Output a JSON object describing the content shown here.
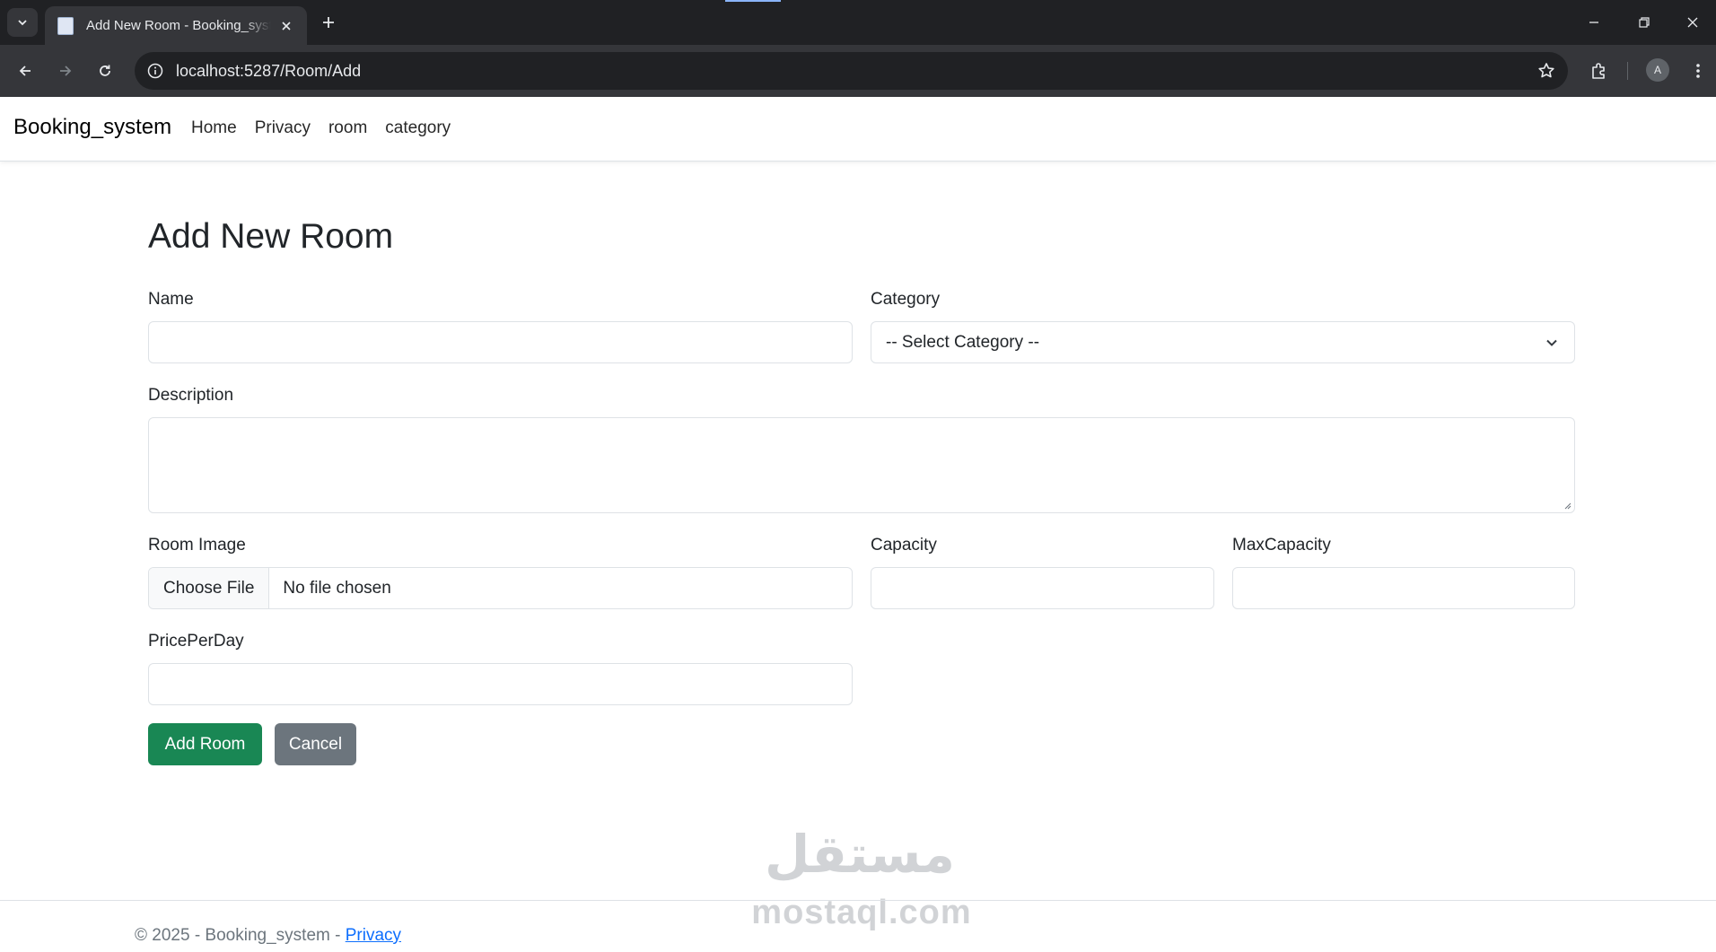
{
  "browser": {
    "tab_title": "Add New Room - Booking_system",
    "url": "localhost:5287/Room/Add",
    "profile_initial": "A"
  },
  "site": {
    "brand": "Booking_system",
    "nav": [
      "Home",
      "Privacy",
      "room",
      "category"
    ]
  },
  "page": {
    "title": "Add New Room"
  },
  "form": {
    "name_label": "Name",
    "name_value": "",
    "category_label": "Category",
    "category_selected": "-- Select Category --",
    "description_label": "Description",
    "description_value": "",
    "image_label": "Room Image",
    "choose_file": "Choose File",
    "no_file": "No file chosen",
    "capacity_label": "Capacity",
    "capacity_value": "",
    "max_capacity_label": "MaxCapacity",
    "max_capacity_value": "",
    "price_label": "PricePerDay",
    "price_value": "",
    "submit_label": "Add Room",
    "cancel_label": "Cancel"
  },
  "footer": {
    "text": "© 2025 - Booking_system - ",
    "privacy_link": "Privacy"
  },
  "watermark": {
    "arabic": "مستقل",
    "latin": "mostaql.com"
  },
  "colors": {
    "success": "#198754",
    "secondary": "#6c757d",
    "link": "#0d6efd"
  }
}
